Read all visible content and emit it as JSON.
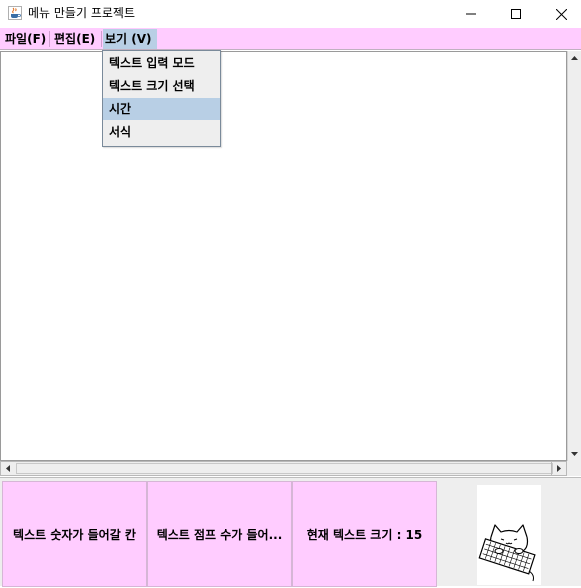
{
  "window": {
    "title": "메뉴 만들기 프로젝트",
    "app_icon": "java-cup-icon"
  },
  "menubar": {
    "items": [
      {
        "label": "파일(F)"
      },
      {
        "label": "편집(E)"
      },
      {
        "label": "보기 (V)"
      }
    ]
  },
  "view_menu": {
    "items": [
      {
        "label": "텍스트 입력 모드"
      },
      {
        "label": "텍스트 크기 선택"
      },
      {
        "label": "시간"
      },
      {
        "label": "서식"
      }
    ],
    "highlighted": "시간"
  },
  "status": {
    "cell1": "텍스트 숫자가 들어갈 칸",
    "cell2": "텍스트 점프 수가 들어...",
    "cell3": "현재 텍스트 크기 : 15"
  },
  "colors": {
    "menubar_bg": "#ffccff",
    "selected_bg": "#b8cfe5",
    "status_cell_bg": "#ffccff"
  }
}
